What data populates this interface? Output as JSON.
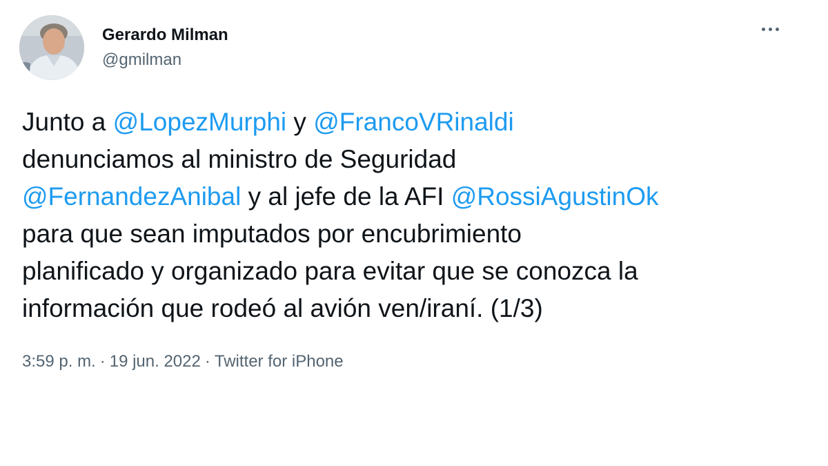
{
  "author": {
    "display_name": "Gerardo Milman",
    "handle": "@gmilman",
    "avatar_icon": "profile-photo"
  },
  "more_icon": "more-horizontal-icon",
  "tweet": {
    "lines": [
      {
        "parts": [
          {
            "text": "Junto a ",
            "type": "text"
          },
          {
            "text": "@LopezMurphi",
            "type": "mention"
          },
          {
            "text": " y ",
            "type": "text"
          },
          {
            "text": "@FrancoVRinaldi",
            "type": "mention"
          }
        ]
      },
      {
        "parts": [
          {
            "text": "denunciamos al ministro de Seguridad",
            "type": "text"
          }
        ]
      },
      {
        "parts": [
          {
            "text": "@FernandezAnibal",
            "type": "mention"
          },
          {
            "text": " y al jefe de la AFI ",
            "type": "text"
          },
          {
            "text": "@RossiAgustinOk",
            "type": "mention"
          }
        ]
      },
      {
        "parts": [
          {
            "text": "para que sean imputados por encubrimiento",
            "type": "text"
          }
        ]
      },
      {
        "parts": [
          {
            "text": "planificado y organizado para evitar que se conozca la",
            "type": "text"
          }
        ]
      },
      {
        "parts": [
          {
            "text": "información que rodeó al avión ven/iraní. (1/3)",
            "type": "text"
          }
        ]
      }
    ]
  },
  "meta": {
    "time": "3:59 p. m.",
    "separator": "·",
    "date": "19 jun. 2022",
    "source": "Twitter for iPhone"
  },
  "colors": {
    "mention": "#1d9bf0",
    "text": "#0f1419",
    "secondary": "#536471",
    "background": "#ffffff"
  }
}
